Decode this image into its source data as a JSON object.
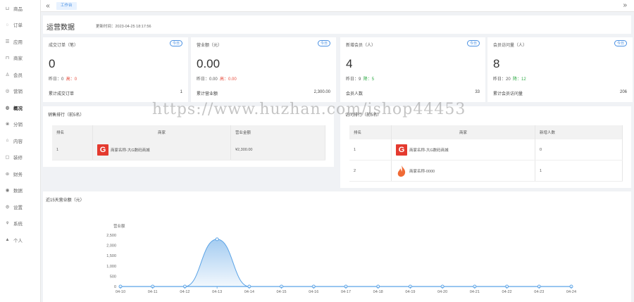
{
  "sidebar": {
    "items": [
      {
        "icon": "bag-icon",
        "glyph": "⊔",
        "label": "商品"
      },
      {
        "icon": "order-icon",
        "glyph": "◌",
        "label": "订单"
      },
      {
        "icon": "app-icon",
        "glyph": "☰",
        "label": "应用"
      },
      {
        "icon": "store-icon",
        "glyph": "⊓",
        "label": "商家"
      },
      {
        "icon": "user-icon",
        "glyph": "♙",
        "label": "会员"
      },
      {
        "icon": "marketing-icon",
        "glyph": "◎",
        "label": "营销"
      },
      {
        "icon": "dashboard-icon",
        "glyph": "◍",
        "label": "概况"
      },
      {
        "icon": "distribution-icon",
        "glyph": "❀",
        "label": "分销"
      },
      {
        "icon": "shop-icon",
        "glyph": "⌂",
        "label": "内容"
      },
      {
        "icon": "decorate-icon",
        "glyph": "▢",
        "label": "装修"
      },
      {
        "icon": "finance-icon",
        "glyph": "⊛",
        "label": "财务"
      },
      {
        "icon": "data-icon",
        "glyph": "◉",
        "label": "数据"
      },
      {
        "icon": "settings-icon",
        "glyph": "⚙",
        "label": "设置"
      },
      {
        "icon": "system-icon",
        "glyph": "⚘",
        "label": "系统"
      },
      {
        "icon": "person-icon",
        "glyph": "▲",
        "label": "个人"
      }
    ]
  },
  "topbar": {
    "prev": "«",
    "tab": "工作台",
    "next": "»"
  },
  "header": {
    "title": "运营数据",
    "update_time": "更新时间：2023-04-25 18:17:56"
  },
  "stats": [
    {
      "label": "成交订单（笔）",
      "badge": "今日",
      "value": "0",
      "sub_a": "昨日：0",
      "sub_b": "高：0",
      "sub_b_color": "red",
      "total_label": "累计成交订单",
      "total": "1"
    },
    {
      "label": "营业额（元）",
      "badge": "今日",
      "value": "0.00",
      "sub_a": "昨日：0.00",
      "sub_b": "高：0.00",
      "sub_b_color": "red",
      "total_label": "累计营业额",
      "total": "2,300.00"
    },
    {
      "label": "新增会员（人）",
      "badge": "今日",
      "value": "4",
      "sub_a": "昨日：9",
      "sub_b": "降：5",
      "sub_b_color": "green",
      "total_label": "会员人数",
      "total": "33"
    },
    {
      "label": "会员访问量（人）",
      "badge": "今日",
      "value": "8",
      "sub_a": "昨日：20",
      "sub_b": "降：12",
      "sub_b_color": "green",
      "total_label": "累计会员访问量",
      "total": "206"
    }
  ],
  "top_sales": {
    "title": "销售排行（前5名）",
    "columns": [
      "排名",
      "商家",
      "营业金额"
    ],
    "rows": [
      {
        "rank": "1",
        "name": "商家名称-大G数码商城",
        "amount": "¥2,300.00"
      }
    ]
  },
  "top_visits": {
    "title": "访问排行（前5名）",
    "columns": [
      "排名",
      "商家",
      "新增人数"
    ],
    "rows": [
      {
        "rank": "1",
        "name": "商家名称-大G数码商城",
        "count": "0"
      },
      {
        "rank": "2",
        "name": "商家名称-0000",
        "count": "1"
      }
    ]
  },
  "watermark": "https://www.huzhan.com/ishop44453",
  "chart_data": {
    "type": "area",
    "title": "近15天营业额（元）",
    "ylabel": "营业额",
    "x": [
      "04-10",
      "04-11",
      "04-12",
      "04-13",
      "04-14",
      "04-15",
      "04-16",
      "04-17",
      "04-18",
      "04-19",
      "04-20",
      "04-21",
      "04-22",
      "04-23",
      "04-24"
    ],
    "series": [
      {
        "name": "营业额",
        "values": [
          0,
          0,
          0,
          2300,
          0,
          0,
          0,
          0,
          0,
          0,
          0,
          0,
          0,
          0,
          0
        ]
      }
    ],
    "ylim": [
      0,
      2500
    ],
    "yticks": [
      "0",
      "500",
      "1,000",
      "1,500",
      "2,000",
      "2,500"
    ],
    "color": "#5ba3e6",
    "smooth": true,
    "grid": false
  }
}
